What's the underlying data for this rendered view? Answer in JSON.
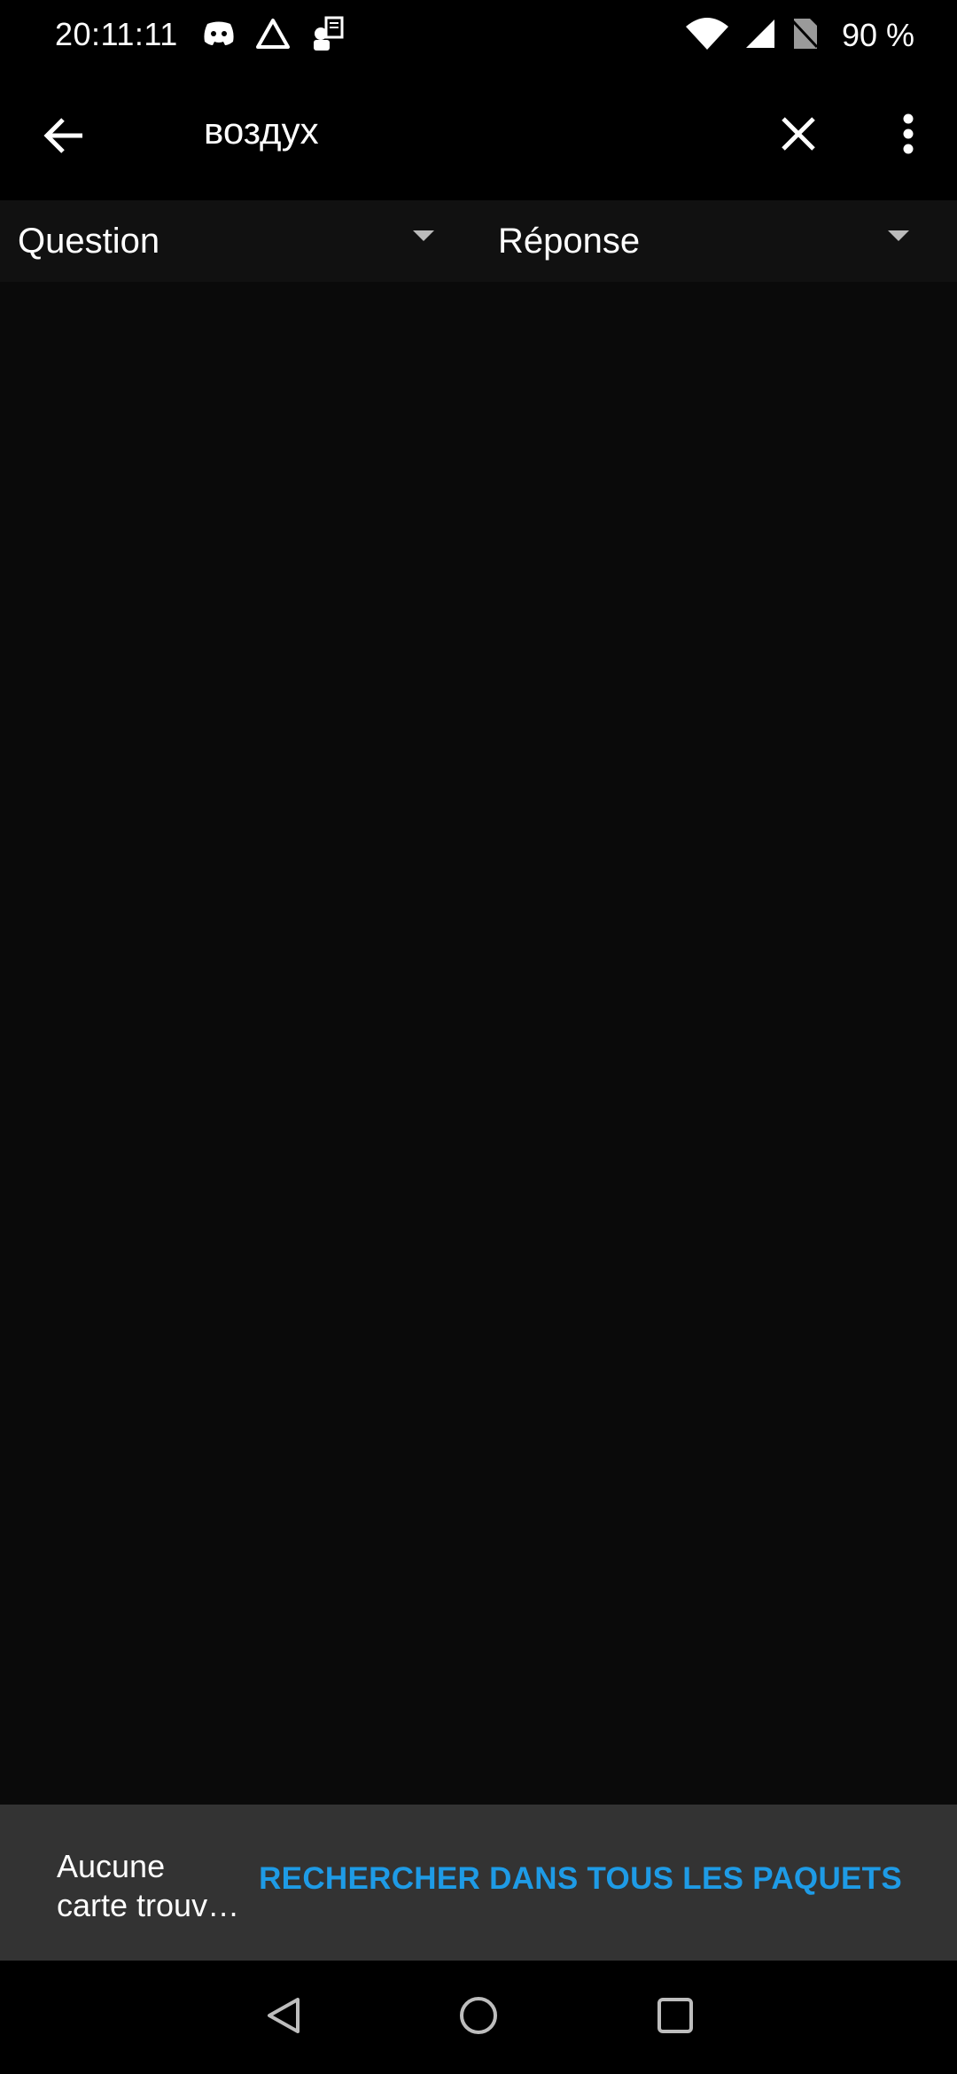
{
  "status_bar": {
    "time": "20:11:11",
    "notification_icons": [
      "discord-icon",
      "warning-triangle-icon",
      "app-notification-icon"
    ],
    "wifi_icon": "wifi-icon",
    "signal_icon": "cell-signal-icon",
    "no_sim_icon": "no-sim-icon",
    "battery": "90 %"
  },
  "toolbar": {
    "back_icon": "arrow-back-icon",
    "search_query": "воздух",
    "clear_icon": "close-icon",
    "more_icon": "more-vert-icon"
  },
  "columns": {
    "question_label": "Question",
    "answer_label": "Réponse"
  },
  "snackbar": {
    "message_line1": "Aucune",
    "message_line2": "carte trouv…",
    "action_label": "RECHERCHER DANS TOUS LES PAQUETS",
    "action_color": "#1e9be6"
  },
  "nav_bar": {
    "back_icon": "nav-back-icon",
    "home_icon": "nav-home-icon",
    "recents_icon": "nav-recents-icon"
  }
}
